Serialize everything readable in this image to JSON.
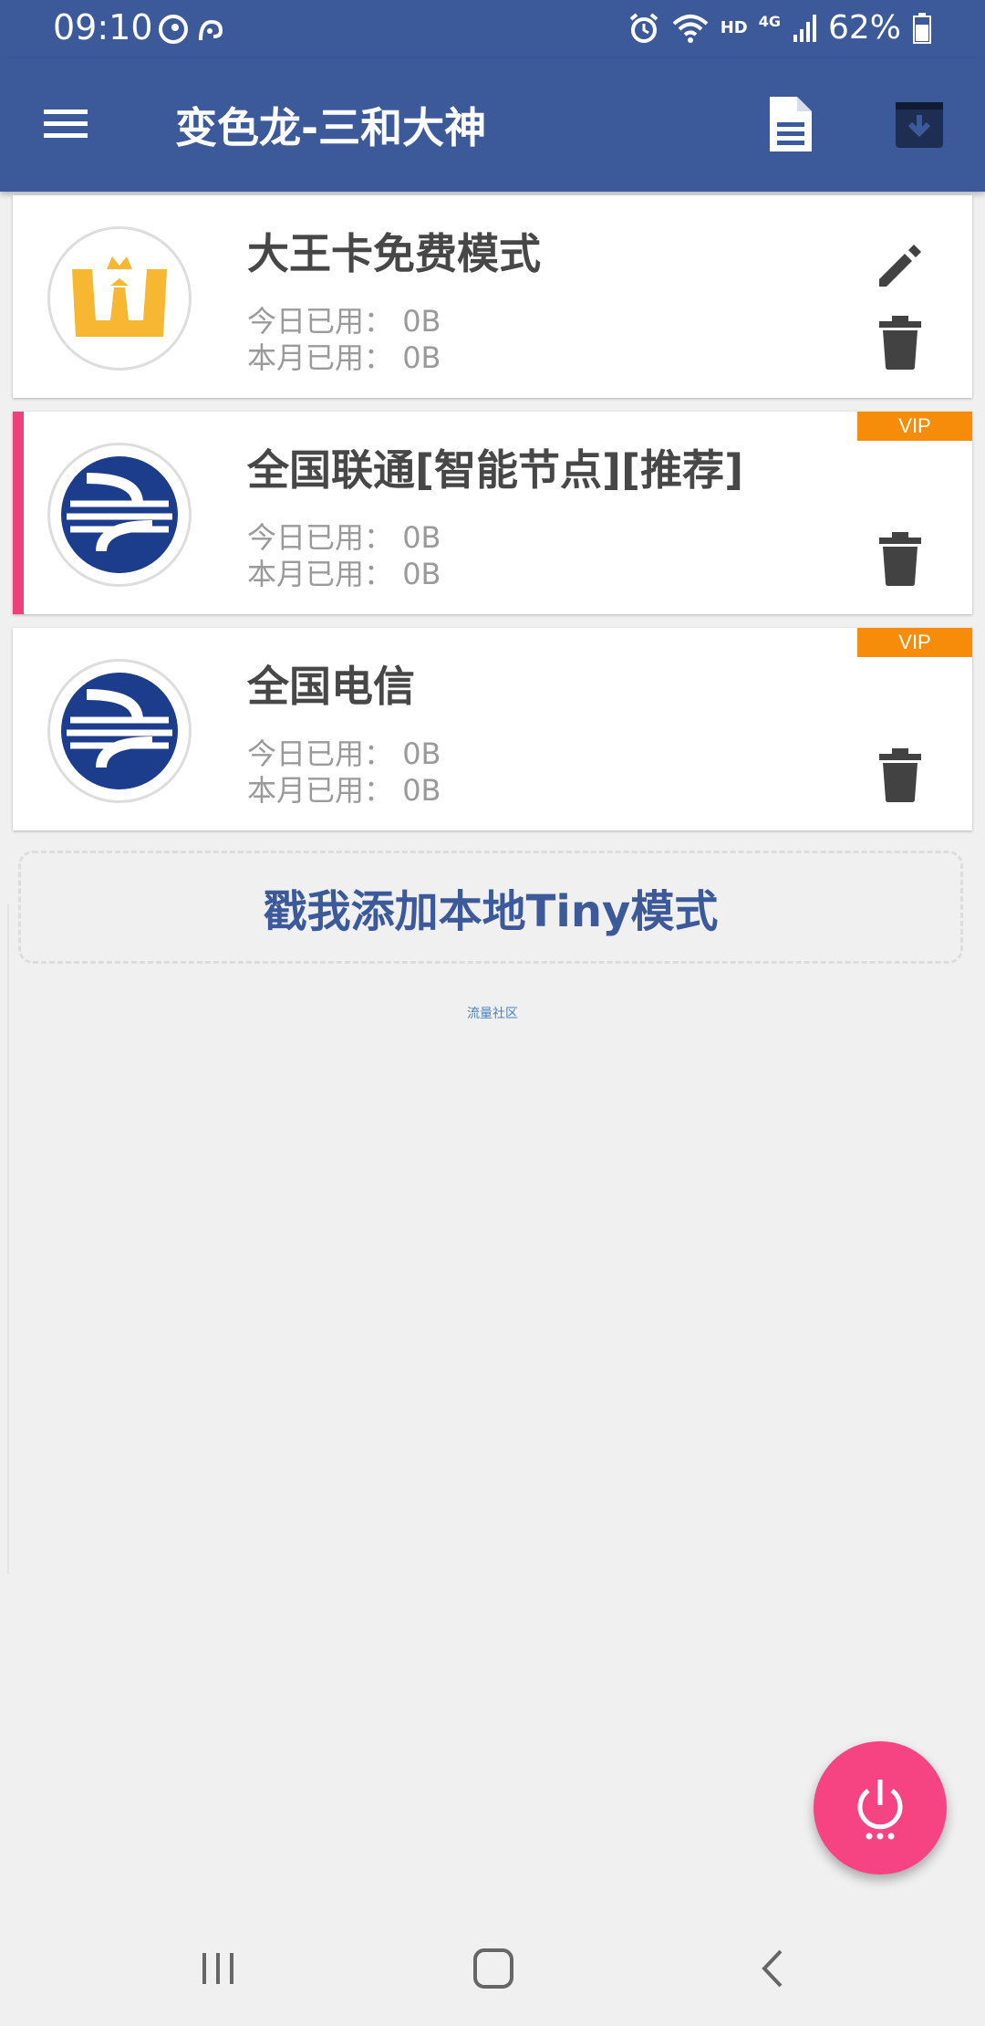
{
  "status_bar": {
    "time": "09:10",
    "hd": "HD",
    "network": "4G",
    "battery": "62%"
  },
  "app_bar": {
    "title": "变色龙-三和大神"
  },
  "modes": [
    {
      "title": "大王卡免费模式",
      "today_label": "今日已用：",
      "today_value": "0B",
      "month_label": "本月已用：",
      "month_value": "0B",
      "logo": "crown-w-logo-icon"
    },
    {
      "title": "全国联通[智能节点][推荐]",
      "today_label": "今日已用：",
      "today_value": "0B",
      "month_label": "本月已用：",
      "month_value": "0B",
      "badge": "VIP",
      "logo": "unicom-logo-icon"
    },
    {
      "title": "全国电信",
      "today_label": "今日已用：",
      "today_value": "0B",
      "month_label": "本月已用：",
      "month_value": "0B",
      "badge": "VIP",
      "logo": "unicom-logo-icon"
    }
  ],
  "add_local": {
    "label": "戳我添加本地Tiny模式"
  },
  "community_link": "流量社区",
  "colors": {
    "primary": "#3c5a9a",
    "accent": "#f64482",
    "vip": "#f78c0a",
    "selected_marker": "#f0407c",
    "logo_gold": "#f7b733",
    "logo_blue": "#1c3c8c"
  }
}
